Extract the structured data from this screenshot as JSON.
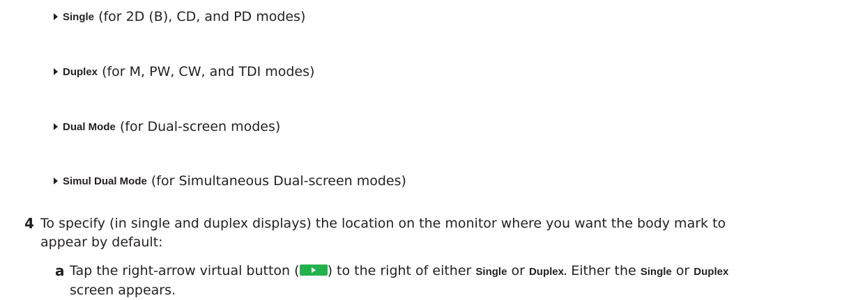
{
  "bullets": [
    {
      "label": "Single",
      "text": "(for 2D (B), CD, and PD modes)"
    },
    {
      "label": "Duplex",
      "text": "(for M, PW, CW, and TDI modes)"
    },
    {
      "label": "Dual Mode",
      "text": "(for Dual-screen modes)"
    },
    {
      "label": "Simul Dual Mode",
      "text": "(for Simultaneous Dual-screen modes)"
    }
  ],
  "step4": {
    "number": "4",
    "line1": "To specify (in single and duplex displays) the location on the monitor where you want the body mark to",
    "line2": "appear by default:"
  },
  "substep_a": {
    "letter": "a",
    "pre": "Tap the right-arrow virtual button (",
    "post": ") to the right of either",
    "single": "Single",
    "or": "or",
    "duplex": "Duplex.",
    "either_the": "Either the",
    "single2": "Single",
    "or2": "or",
    "duplex2": "Duplex",
    "line2": "screen appears.",
    "button_color": "#22b24c"
  }
}
